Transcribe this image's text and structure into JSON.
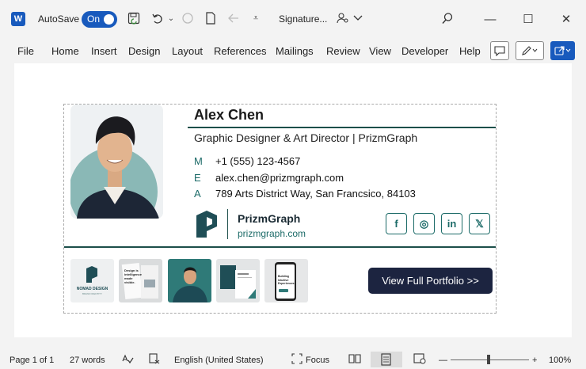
{
  "titlebar": {
    "app_logo": "W",
    "autosave_label": "AutoSave",
    "autosave_state": "On",
    "doc_title": "Signature...",
    "icons": [
      "save-icon",
      "undo-icon",
      "redo-icon",
      "new-doc-icon",
      "back-icon",
      "customize-icon",
      "user-search-icon",
      "chevron-down-icon",
      "search-icon"
    ],
    "window_controls": {
      "minimize": "—",
      "maximize": "☐",
      "close": "✕"
    }
  },
  "menu": {
    "items": [
      "File",
      "Home",
      "Insert",
      "Design",
      "Layout",
      "References",
      "Mailings",
      "Review",
      "View",
      "Developer",
      "Help"
    ]
  },
  "signature": {
    "name": "Alex Chen",
    "job_title": "Graphic Designer & Art Director | PrizmGraph",
    "contacts": [
      {
        "letter": "M",
        "value": "+1 (555) 123-4567"
      },
      {
        "letter": "E",
        "value": "alex.chen@prizmgraph.com"
      },
      {
        "letter": "A",
        "value": "789 Arts District Way, San Francsico, 84103"
      }
    ],
    "brand_name": "PrizmGraph",
    "brand_url": "prizmgraph.com",
    "social": [
      {
        "label": "f",
        "icon": "facebook-icon"
      },
      {
        "label": "◎",
        "icon": "instagram-icon"
      },
      {
        "label": "in",
        "icon": "linkedin-icon"
      },
      {
        "label": "𝕏",
        "icon": "x-icon"
      }
    ],
    "thumbnails": {
      "nomad_title": "NOMAD DESIGN",
      "nomad_sub": "BRAND IDENTITY",
      "magazine_text": "Design is intelligence made visible.",
      "phone_text": "Building Intuitive Experiences"
    },
    "portfolio_button": "View Full Portfolio >>",
    "colors": {
      "accent": "#1c6b68",
      "rule": "#1c4f4a",
      "button": "#1c2440"
    }
  },
  "status": {
    "page": "Page 1 of 1",
    "words": "27 words",
    "language": "English (United States)",
    "focus": "Focus",
    "zoom_minus": "—",
    "zoom_plus": "+",
    "zoom": "100%",
    "zoom_level": 0.5
  }
}
